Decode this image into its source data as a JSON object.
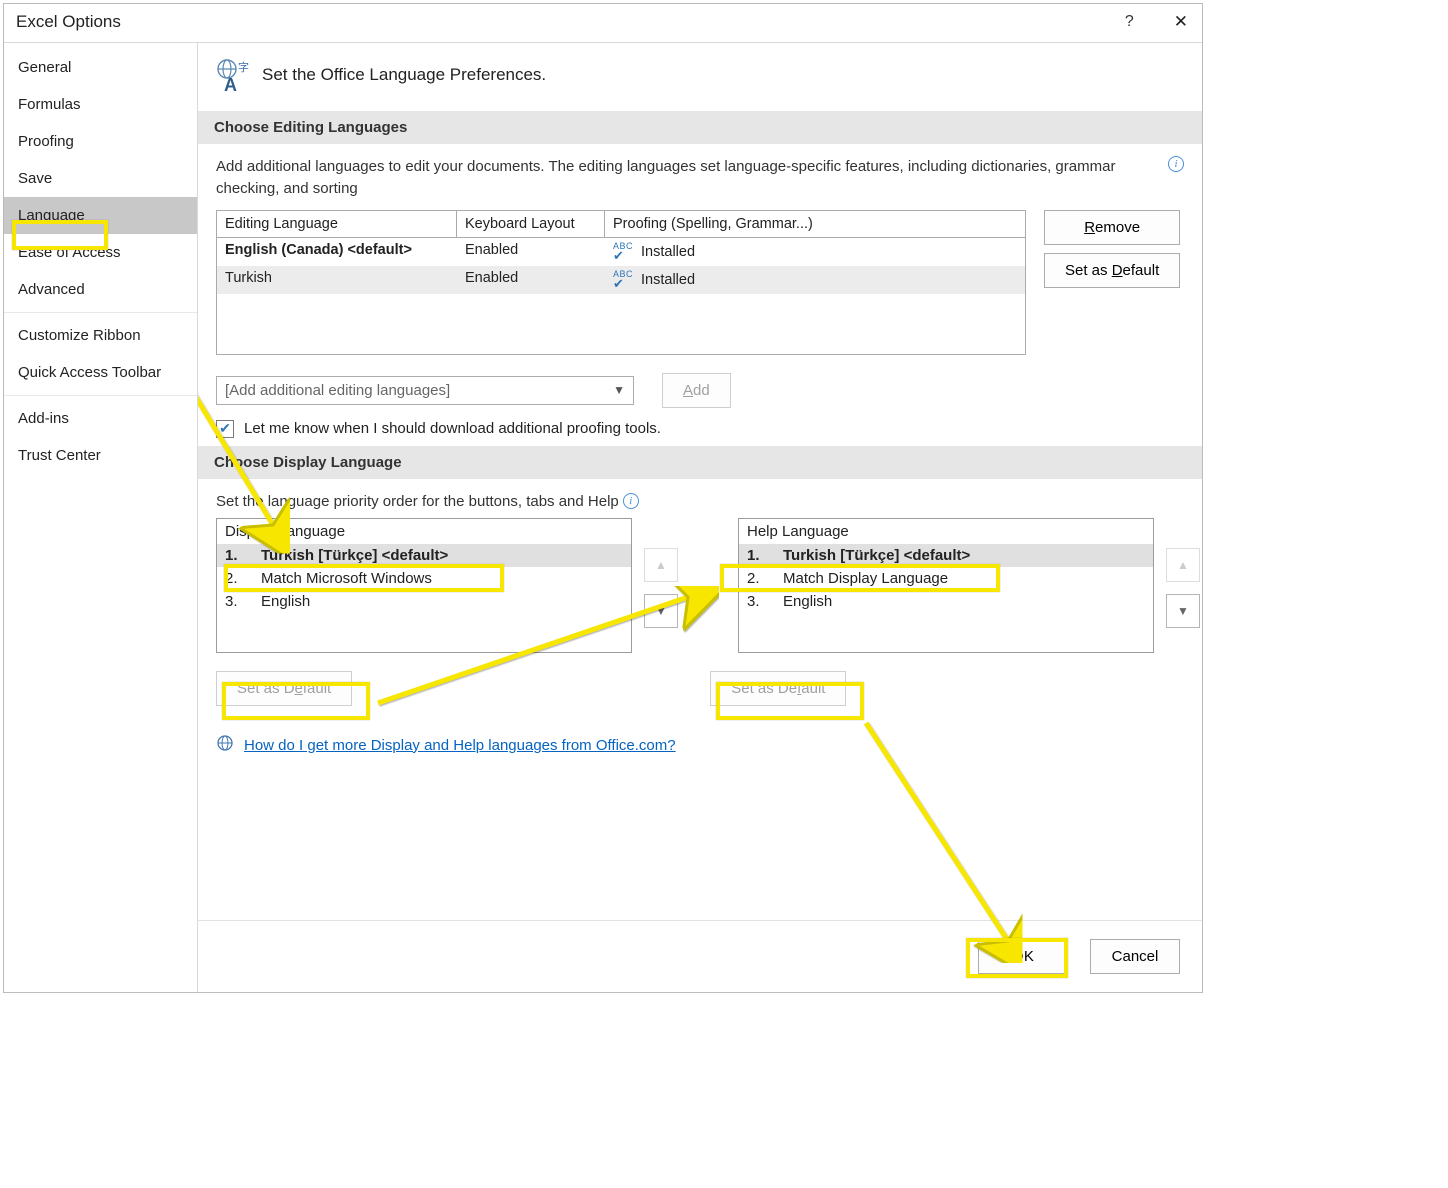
{
  "titlebar": {
    "title": "Excel Options"
  },
  "sidebar": {
    "items": [
      {
        "label": "General"
      },
      {
        "label": "Formulas"
      },
      {
        "label": "Proofing"
      },
      {
        "label": "Save"
      },
      {
        "label": "Language",
        "selected": true
      },
      {
        "label": "Ease of Access"
      },
      {
        "label": "Advanced"
      }
    ],
    "items2": [
      {
        "label": "Customize Ribbon"
      },
      {
        "label": "Quick Access Toolbar"
      }
    ],
    "items3": [
      {
        "label": "Add-ins"
      },
      {
        "label": "Trust Center"
      }
    ]
  },
  "header": {
    "title": "Set the Office Language Preferences."
  },
  "editing": {
    "section_title": "Choose Editing Languages",
    "desc": "Add additional languages to edit your documents. The editing languages set language-specific features, including dictionaries, grammar checking, and sorting",
    "columns": {
      "c1": "Editing Language",
      "c2": "Keyboard Layout",
      "c3": "Proofing (Spelling, Grammar...)"
    },
    "rows": [
      {
        "lang": "English (Canada) <default>",
        "layout": "Enabled",
        "proof": "Installed",
        "bold": true
      },
      {
        "lang": "Turkish",
        "layout": "Enabled",
        "proof": "Installed",
        "alt": true
      }
    ],
    "remove_btn": "Remove",
    "set_default_btn": "Set as Default",
    "combo_placeholder": "[Add additional editing languages]",
    "add_btn": "Add",
    "notify_label": "Let me know when I should download additional proofing tools."
  },
  "display": {
    "section_title": "Choose Display Language",
    "desc": "Set the language priority order for the buttons, tabs and Help",
    "display_header": "Display Language",
    "help_header": "Help Language",
    "display_list": [
      {
        "num": "1.",
        "label": "Turkish [Türkçe] <default>",
        "sel": true
      },
      {
        "num": "2.",
        "label": "Match Microsoft Windows"
      },
      {
        "num": "3.",
        "label": "English"
      }
    ],
    "help_list": [
      {
        "num": "1.",
        "label": "Turkish [Türkçe] <default>",
        "sel": true
      },
      {
        "num": "2.",
        "label": "Match Display Language"
      },
      {
        "num": "3.",
        "label": "English"
      }
    ],
    "set_default_btn": "Set as Default",
    "more_link": "How do I get more Display and Help languages from Office.com?"
  },
  "footer": {
    "ok": "OK",
    "cancel": "Cancel"
  }
}
